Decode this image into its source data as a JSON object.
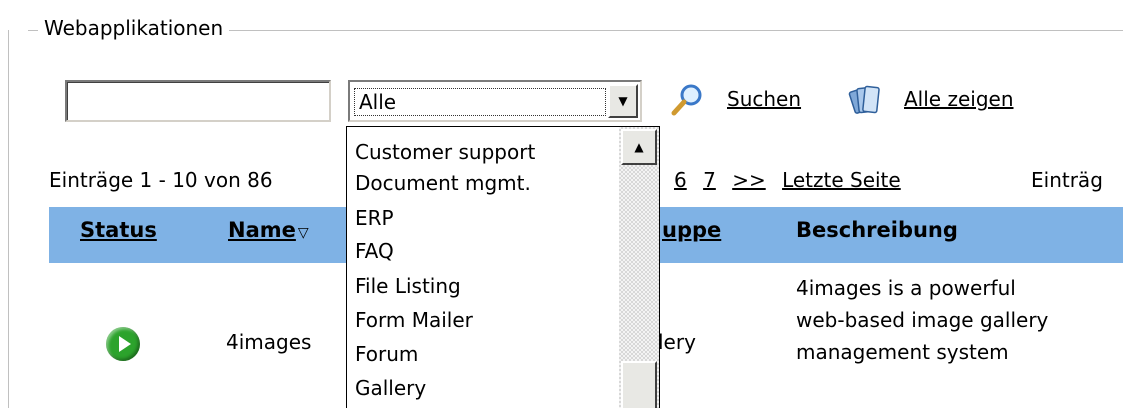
{
  "fieldset": {
    "legend": "Webapplikationen"
  },
  "search": {
    "input_value": "",
    "category_selected": "Alle",
    "search_label": "Suchen",
    "show_all_label": "Alle zeigen"
  },
  "dropdown": {
    "options": [
      "Customer support",
      "Document mgmt.",
      "ERP",
      "FAQ",
      "File Listing",
      "Form Mailer",
      "Forum",
      "Gallery"
    ]
  },
  "listing": {
    "entries_info": "Einträge 1 - 10 von 86",
    "pager": [
      "6",
      "7",
      ">>",
      "Letzte Seite"
    ],
    "entries_right": "Einträg"
  },
  "table": {
    "headers": {
      "status": "Status",
      "name": "Name",
      "group": "uppe",
      "description": "Beschreibung"
    },
    "rows": [
      {
        "status_icon": "play-icon",
        "name": "4images",
        "group": "lery",
        "description": "4images is a powerful web-based image gallery management system"
      }
    ]
  },
  "colors": {
    "header_bg": "#7fb2e5",
    "status_green": "#2ca32c"
  }
}
